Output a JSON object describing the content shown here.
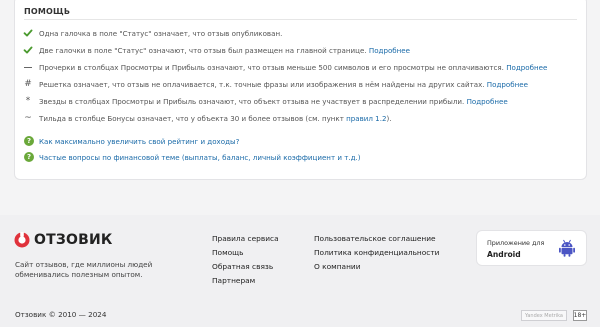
{
  "help": {
    "title": "ПОМОЩЬ",
    "rows": [
      {
        "icon": "single-check-icon",
        "text": "Одна галочка в поле \"Статус\" означает, что отзыв опубликован.",
        "link": ""
      },
      {
        "icon": "double-check-icon",
        "text": "Две галочки в поле \"Статус\" означают, что отзыв был размещен на главной странице.",
        "link": "Подробнее"
      },
      {
        "icon": "dash-icon",
        "text": "Прочерки в столбцах Просмотры и Прибыль означают, что отзыв меньше 500 символов и его просмотры не оплачиваются.",
        "link": "Подробнее"
      },
      {
        "icon": "hash-icon",
        "symbol": "#",
        "text": "Решетка означает, что отзыв не оплачивается, т.к. точные фразы или изображения в нём найдены на других сайтах.",
        "link": "Подробнее"
      },
      {
        "icon": "asterisk-icon",
        "symbol": "*",
        "text": "Звезды в столбцах Просмотры и Прибыль означают, что объект отзыва не участвует в распределении прибыли.",
        "link": "Подробнее"
      },
      {
        "icon": "tilde-icon",
        "symbol": "~",
        "text": "Тильда в столбце Бонусы означает, что у объекта 30 и более отзывов (см. пункт ",
        "link": "правил 1.2",
        "tail": ")."
      }
    ],
    "faq": [
      {
        "text": "Как максимально увеличить свой рейтинг и доходы?"
      },
      {
        "text": "Частые вопросы по финансовой теме (выплаты, баланс, личный коэффициент и т.д.)"
      }
    ]
  },
  "footer": {
    "logo_text": "ОТЗОВИК",
    "tagline": "Сайт отзывов, где миллионы людей обменивались полезным опытом.",
    "col1": [
      "Правила сервиса",
      "Помощь",
      "Обратная связь",
      "Партнерам"
    ],
    "col2": [
      "Пользовательское соглашение",
      "Политика конфиденциальности",
      "О компании"
    ],
    "app": {
      "small": "Приложение для",
      "big": "Android"
    },
    "copyright": "Отзовик © 2010 — 2024",
    "counter": "Yandex Metrika",
    "age": "18+"
  },
  "colors": {
    "check": "#4a9a2e",
    "link": "#1a6aa8",
    "logo_red": "#e0323c",
    "faq_icon": "#6aa83a",
    "android": "#4b55c4"
  }
}
